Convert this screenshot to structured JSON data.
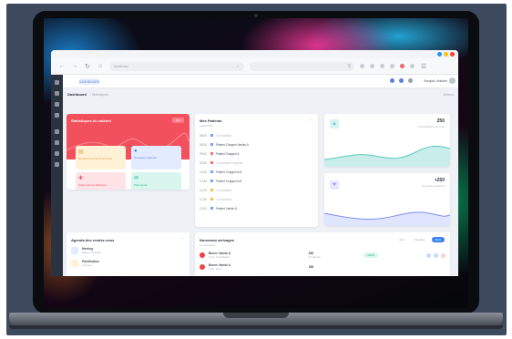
{
  "browser": {
    "url": "localhost",
    "colors": {
      "dot1": "#2196f3",
      "dot2": "#ffc107",
      "dot3": "#f44336"
    }
  },
  "app": {
    "chip_label": "DASHBOARD",
    "user_name": "Bonjour, Antoine",
    "breadcrumb": "Dashboard",
    "breadcrumb_sub": "/ Statistiques",
    "top_right_action": "Actions"
  },
  "stats_card": {
    "title": "Statistiques du cabinet",
    "button_label": "Voir",
    "tiles": [
      {
        "label": "Rendez-vous de la semaine",
        "icon": "chart-icon"
      },
      {
        "label": "Nouveaux patients",
        "icon": "user-icon"
      },
      {
        "label": "Ordonnances délivrées",
        "icon": "plus-icon"
      },
      {
        "label": "Paiements",
        "icon": "mail-icon"
      }
    ],
    "colors": {
      "accent": "#f2505d",
      "tile1": "#fff1d6",
      "tile2": "#e2ebff",
      "tile3": "#ffe3e6",
      "tile4": "#d9f6ee"
    }
  },
  "patients_card": {
    "title": "Mes Patients",
    "subtitle": "Aujourd'hui",
    "items": [
      {
        "time": "08:00",
        "text": "Consultation",
        "muted": true,
        "color": "#3b82f6"
      },
      {
        "time": "08:30",
        "text": "Patient Chappel Vanish A",
        "muted": false,
        "color": "#3b82f6"
      },
      {
        "time": "09:00",
        "text": "Patient Chappel A",
        "muted": false,
        "color": "#ef4444"
      },
      {
        "time": "09:30",
        "text": "Consultation urgente",
        "muted": true,
        "color": "#ef4444"
      },
      {
        "time": "10:00",
        "text": "Patient Chappel A B",
        "muted": false,
        "color": "#3b82f6"
      },
      {
        "time": "10:30",
        "text": "Patient Chappel A B",
        "muted": false,
        "color": "#3b82f6"
      },
      {
        "time": "11:00",
        "text": "Consultation",
        "muted": true,
        "color": "#f59e0b"
      },
      {
        "time": "11:30",
        "text": "Consultation",
        "muted": true,
        "color": "#f59e0b"
      },
      {
        "time": "12:00",
        "text": "Patient Vanish A",
        "muted": false,
        "color": "#3b82f6"
      }
    ]
  },
  "metric_cards": [
    {
      "value": "250",
      "caption": "Consultations ce mois",
      "icon": "chart-icon",
      "color": "#5cc8c0",
      "fill": "#c9eeea"
    },
    {
      "value": "+250",
      "caption": "Nouveaux patients",
      "icon": "heart-icon",
      "color": "#7b8ff0",
      "fill": "#dfe4ff"
    }
  ],
  "agenda_card": {
    "title": "Agenda des rendez-vous",
    "items": [
      {
        "title": "Meeting",
        "sub": "Équipe médicale",
        "color": "#3b82f6"
      },
      {
        "title": "Planification",
        "sub": "Semaine",
        "color": "#f59e0b"
      }
    ]
  },
  "revenue_card": {
    "title": "Nouveaux arrivages",
    "subtitle": "12 nouveaux",
    "filters": [
      "Jour",
      "Semaine",
      "Mois"
    ],
    "rows": [
      {
        "name": "Bonne Vanish A",
        "type": "Type: Consultation",
        "amount": "$80",
        "amount_sub": "En attente",
        "status": "Validé",
        "color": "#ef4444"
      },
      {
        "name": "Bonne Vanish A",
        "type": "Type: Suivi",
        "amount": "$80",
        "amount_sub": "",
        "status": "",
        "color": "#ef4444"
      }
    ]
  }
}
